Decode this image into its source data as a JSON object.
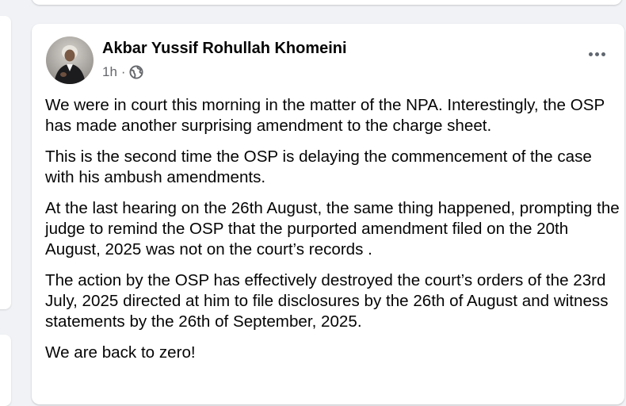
{
  "post": {
    "author": "Akbar Yussif Rohullah Khomeini",
    "timestamp": "1h",
    "separator": "·",
    "privacy_icon": "globe-icon",
    "more_icon": "more-options-icon",
    "paragraphs": [
      "We were in court this morning in the matter of the NPA. Interestingly, the OSP has made another surprising amendment to the charge sheet.",
      "This is the second time the OSP is delaying the commencement of the case with his ambush amendments.",
      "At the last hearing on the 26th August, the same thing happened, prompting the judge to remind the OSP that the purported amendment filed on the 20th August, 2025 was not on the court’s records .",
      "The action by the OSP has effectively destroyed the court’s orders of the 23rd July, 2025 directed at him to file disclosures by the 26th of August and witness statements by the 26th of September, 2025.",
      "We are back to zero!"
    ]
  },
  "colors": {
    "page_background": "#f0f2f5",
    "card_background": "#ffffff",
    "primary_text": "#050505",
    "secondary_text": "#65676b"
  }
}
